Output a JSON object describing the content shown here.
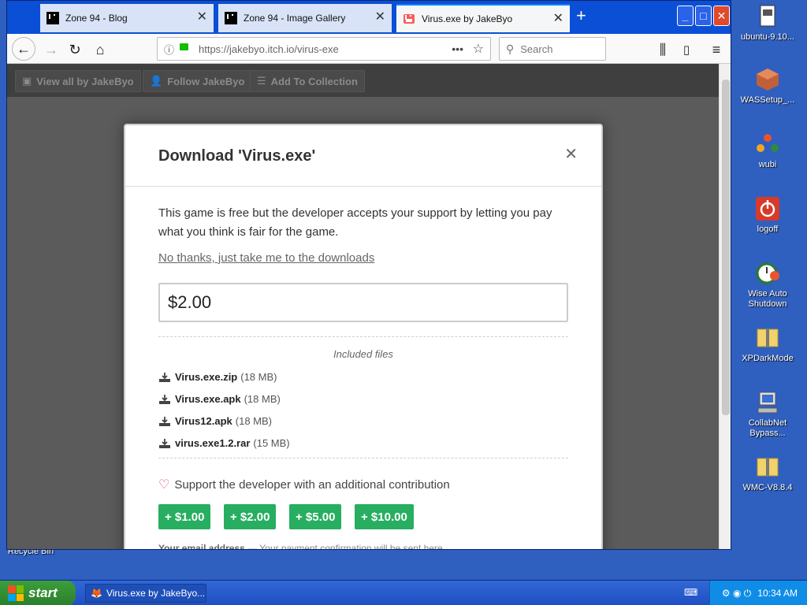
{
  "browser": {
    "tabs": [
      {
        "label": "Zone 94 - Blog"
      },
      {
        "label": "Zone 94 - Image Gallery"
      },
      {
        "label": "Virus.exe by JakeByo"
      }
    ],
    "url": "https://jakebyo.itch.io/virus-exe",
    "search_placeholder": "Search"
  },
  "page": {
    "topbar": [
      "View all by JakeByo",
      "Follow JakeByo",
      "Add To Collection"
    ]
  },
  "modal": {
    "title_prefix": "Download '",
    "title_name": "Virus.exe",
    "title_suffix": "'",
    "intro": "This game is free but the developer accepts your support by letting you pay what you think is fair for the game.",
    "no_thanks": "No thanks, just take me to the downloads",
    "amount": "$2.00",
    "included_files_label": "Included files",
    "files": [
      {
        "name": "Virus.exe.zip",
        "size": "(18 MB)"
      },
      {
        "name": "Virus.exe.apk",
        "size": "(18 MB)"
      },
      {
        "name": "Virus12.apk",
        "size": "(18 MB)"
      },
      {
        "name": "virus.exe1.2.rar",
        "size": "(15 MB)"
      }
    ],
    "support_text": "Support the developer with an additional contribution",
    "contrib_buttons": [
      "+ $1.00",
      "+ $2.00",
      "+ $5.00",
      "+ $10.00"
    ],
    "email_label": "Your email address",
    "email_hint": "Your payment confirmation will be sent here"
  },
  "desktop_icons": [
    {
      "label": "ubuntu-9.10...",
      "icon": "document-icon"
    },
    {
      "label": "WASSetup_...",
      "icon": "package-icon"
    },
    {
      "label": "wubi",
      "icon": "ubuntu-icon"
    },
    {
      "label": "logoff",
      "icon": "power-icon"
    },
    {
      "label": "Wise Auto Shutdown",
      "icon": "clock-icon"
    },
    {
      "label": "XPDarkMode",
      "icon": "zip-folder-icon"
    },
    {
      "label": "CollabNet Bypass...",
      "icon": "computer-icon"
    },
    {
      "label": "WMC-V8.8.4",
      "icon": "zip-folder-icon"
    }
  ],
  "recycle_bin": "Recycle Bin",
  "taskbar": {
    "start": "start",
    "task_item": "Virus.exe by JakeByo...",
    "clock": "10:34 AM"
  }
}
